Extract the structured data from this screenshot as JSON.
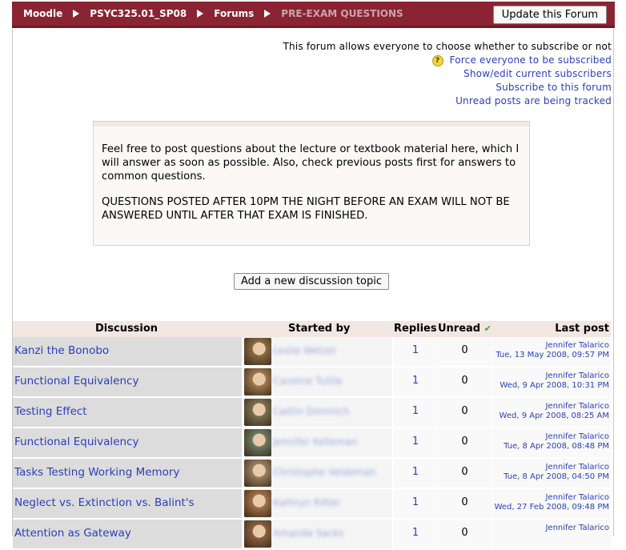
{
  "navbar": {
    "crumbs": [
      "Moodle",
      "PSYC325.01_SP08",
      "Forums",
      "PRE-EXAM QUESTIONS"
    ],
    "update_button": "Update this Forum"
  },
  "subscription": {
    "note": "This forum allows everyone to choose whether to subscribe or not",
    "force": "Force everyone to be subscribed",
    "show_edit": "Show/edit current subscribers",
    "subscribe": "Subscribe to this forum",
    "tracking": "Unread posts are being tracked"
  },
  "intro": {
    "p1": "Feel free to post questions about the lecture or textbook material here, which I will answer as soon as possible. Also, check previous posts first for answers to common questions.",
    "p2": "QUESTIONS POSTED AFTER 10PM THE NIGHT BEFORE AN EXAM WILL NOT BE ANSWERED UNTIL AFTER THAT EXAM IS FINISHED."
  },
  "add_topic_button": "Add a new discussion topic",
  "table": {
    "headers": {
      "discussion": "Discussion",
      "started_by": "Started by",
      "replies": "Replies",
      "unread": "Unread",
      "last_post": "Last post"
    },
    "rows": [
      {
        "topic": "Kanzi the Bonobo",
        "starter": "Leslie Wetzel",
        "replies": "1",
        "unread": "0",
        "last_by": "Jennifer Talarico",
        "last_date": "Tue, 13 May 2008, 09:57 PM",
        "avatar_color": "#8a6a45"
      },
      {
        "topic": "Functional Equivalency",
        "starter": "Caroline Tuttle",
        "replies": "1",
        "unread": "0",
        "last_by": "Jennifer Talarico",
        "last_date": "Wed, 9 Apr 2008, 10:31 PM",
        "avatar_color": "#a07850"
      },
      {
        "topic": "Testing Effect",
        "starter": "Caitlin Dimmich",
        "replies": "1",
        "unread": "0",
        "last_by": "Jennifer Talarico",
        "last_date": "Wed, 9 Apr 2008, 08:25 AM",
        "avatar_color": "#7a7050"
      },
      {
        "topic": "Functional Equivalency",
        "starter": "Jennifer Kelleman",
        "replies": "1",
        "unread": "0",
        "last_by": "Jennifer Talarico",
        "last_date": "Tue, 8 Apr 2008, 08:48 PM",
        "avatar_color": "#6a7a60"
      },
      {
        "topic": "Tasks Testing Working Memory",
        "starter": "Christophe Veldeman",
        "replies": "1",
        "unread": "0",
        "last_by": "Jennifer Talarico",
        "last_date": "Tue, 8 Apr 2008, 04:50 PM",
        "avatar_color": "#9a8060"
      },
      {
        "topic": "Neglect vs. Extinction vs. Balint's",
        "starter": "Kathryn Ritter",
        "replies": "1",
        "unread": "0",
        "last_by": "Jennifer Talarico",
        "last_date": "Wed, 27 Feb 2008, 09:48 PM",
        "avatar_color": "#a07048"
      },
      {
        "topic": "Attention as Gateway",
        "starter": "Amanda Sacks",
        "replies": "1",
        "unread": "0",
        "last_by": "Jennifer Talarico",
        "last_date": "",
        "avatar_color": "#8a6040"
      }
    ]
  },
  "icons": {
    "separator": "triangle-right-icon",
    "help": "help-icon",
    "tracking": "checkmark-icon"
  }
}
